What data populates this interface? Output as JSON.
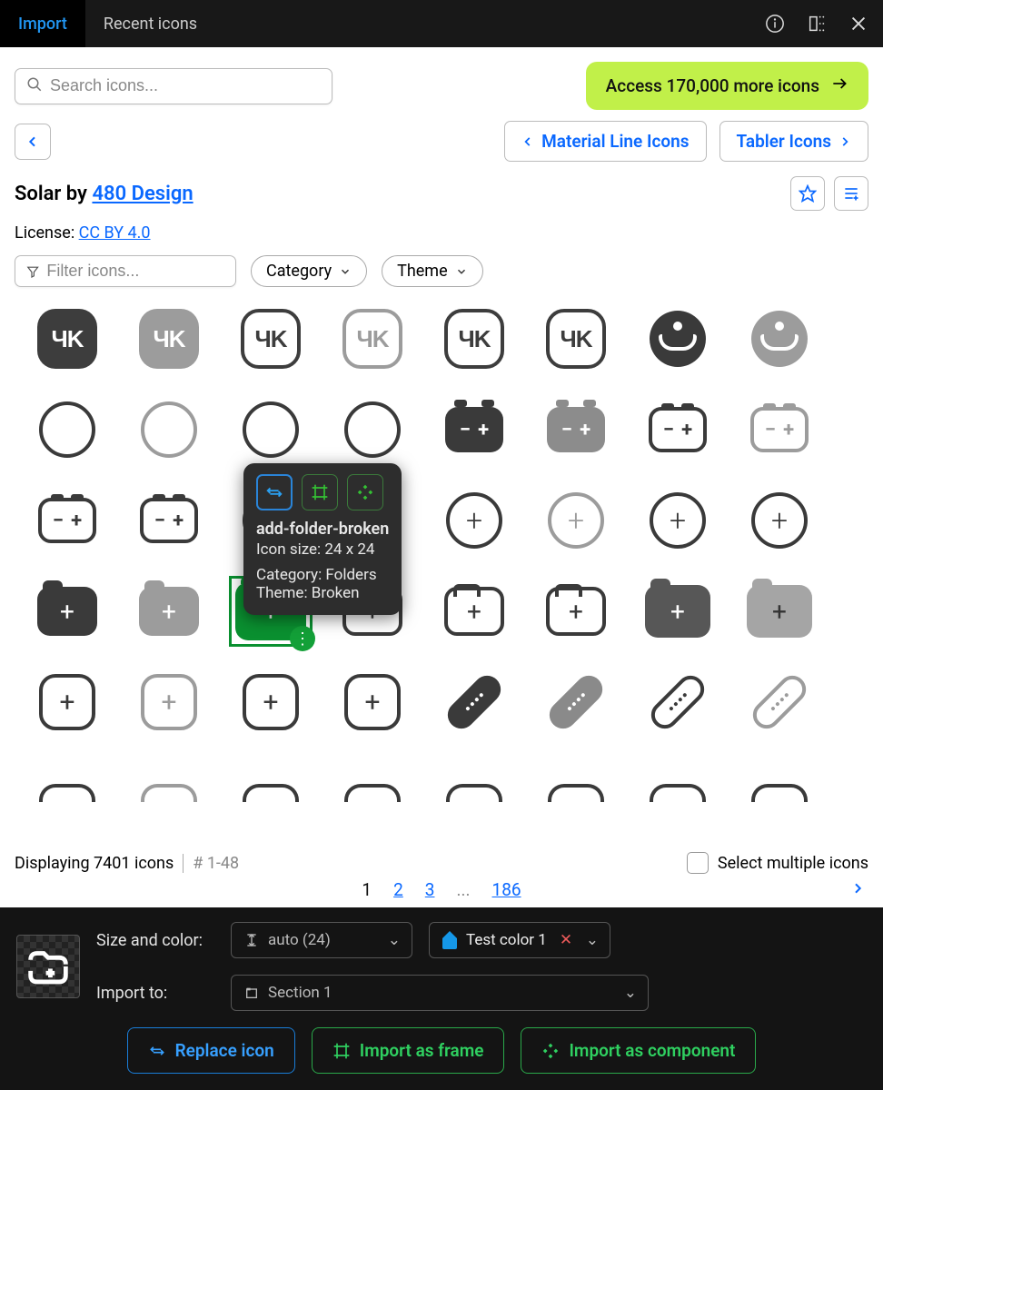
{
  "header": {
    "tabs": {
      "import": "Import",
      "recent": "Recent icons"
    }
  },
  "search": {
    "placeholder": "Search icons..."
  },
  "promo": {
    "label": "Access 170,000 more icons"
  },
  "nav": {
    "material": "Material Line Icons",
    "tabler": "Tabler Icons"
  },
  "title": {
    "prefix": "Solar by ",
    "author": "480 Design"
  },
  "license": {
    "label": "License: ",
    "name": "CC BY 4.0"
  },
  "filter": {
    "placeholder": "Filter icons...",
    "category": "Category",
    "theme": "Theme"
  },
  "popup": {
    "title": "add-folder-broken",
    "size": "Icon size: 24 x 24",
    "category": "Category: Folders",
    "theme": "Theme: Broken"
  },
  "status": {
    "count": "Displaying 7401 icons",
    "range": "# 1-48",
    "multi": "Select multiple icons"
  },
  "pagination": {
    "p1": "1",
    "p2": "2",
    "p3": "3",
    "dots": "...",
    "last": "186"
  },
  "footer": {
    "size_label": "Size and color:",
    "size_value": "auto (24)",
    "color_value": "Test color 1",
    "import_label": "Import to:",
    "section_value": "Section 1",
    "replace": "Replace icon",
    "as_frame": "Import as frame",
    "as_component": "Import as component"
  }
}
